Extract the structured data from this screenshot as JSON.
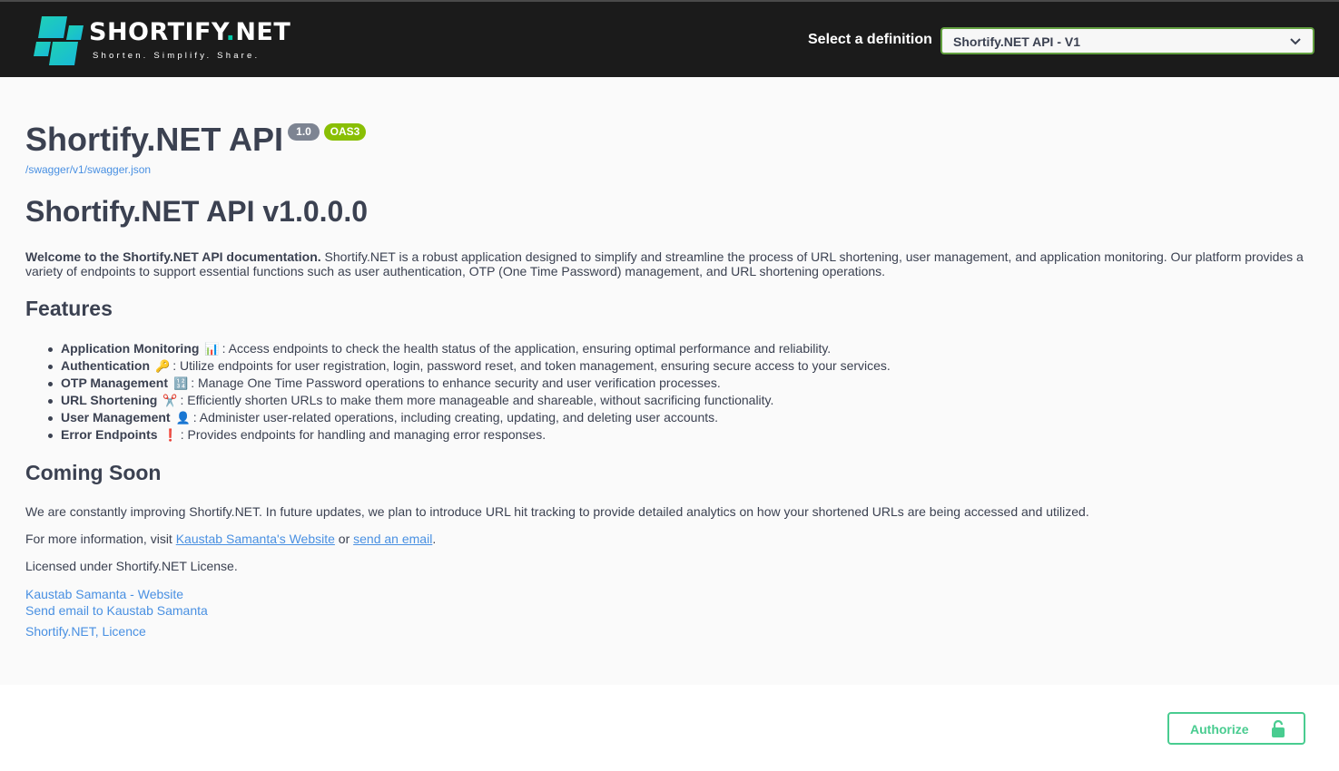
{
  "header": {
    "logo_title_main": "SHORTIFY",
    "logo_title_dot": ".",
    "logo_title_suffix": "NET",
    "logo_tagline": "Shorten. Simplify. Share.",
    "definition_label": "Select a definition",
    "definition_selected": "Shortify.NET API - V1"
  },
  "info": {
    "title": "Shortify.NET API",
    "version_badge": "1.0",
    "oas_badge": "OAS3",
    "spec_url": "/swagger/v1/swagger.json",
    "api_heading": "Shortify.NET API v1.0.0.0",
    "intro_bold": "Welcome to the Shortify.NET API documentation.",
    "intro_text": " Shortify.NET is a robust application designed to simplify and streamline the process of URL shortening, user management, and application monitoring. Our platform provides a variety of endpoints to support essential functions such as user authentication, OTP (One Time Password) management, and URL shortening operations.",
    "features_heading": "Features",
    "features": [
      {
        "name": "Application Monitoring",
        "emoji": "📊",
        "desc": ": Access endpoints to check the health status of the application, ensuring optimal performance and reliability."
      },
      {
        "name": "Authentication",
        "emoji": "🔑",
        "desc": ": Utilize endpoints for user registration, login, password reset, and token management, ensuring secure access to your services."
      },
      {
        "name": "OTP Management",
        "emoji": "🔢",
        "desc": ": Manage One Time Password operations to enhance security and user verification processes."
      },
      {
        "name": "URL Shortening",
        "emoji": "✂️",
        "desc": ": Efficiently shorten URLs to make them more manageable and shareable, without sacrificing functionality."
      },
      {
        "name": "User Management",
        "emoji": "👤",
        "desc": ": Administer user-related operations, including creating, updating, and deleting user accounts."
      },
      {
        "name": "Error Endpoints",
        "emoji": "❗",
        "desc": ": Provides endpoints for handling and managing error responses."
      }
    ],
    "coming_soon_heading": "Coming Soon",
    "coming_soon_text": "We are constantly improving Shortify.NET. In future updates, we plan to introduce URL hit tracking to provide detailed analytics on how your shortened URLs are being accessed and utilized.",
    "more_info_prefix": "For more information, visit ",
    "more_info_link1": "Kaustab Samanta's Website",
    "more_info_or": " or ",
    "more_info_link2": "send an email",
    "more_info_suffix": ".",
    "license_text": "Licensed under Shortify.NET License.",
    "contact_website": "Kaustab Samanta - Website",
    "contact_email": "Send email to Kaustab Samanta",
    "license_link": "Shortify.NET, Licence"
  },
  "scheme": {
    "authorize_label": "Authorize"
  },
  "colors": {
    "topbar": "#1b1b1b",
    "link": "#4990e2",
    "oas_badge": "#89bf04",
    "version_badge": "#7d8492",
    "authorize": "#49cc90",
    "select_border": "#62a03f",
    "logo_accent": "#00c9a7"
  },
  "icons": {
    "logo": "shortify-logo-icon",
    "select_arrow": "chevron-down-icon",
    "authorize": "unlocked-padlock-icon"
  }
}
